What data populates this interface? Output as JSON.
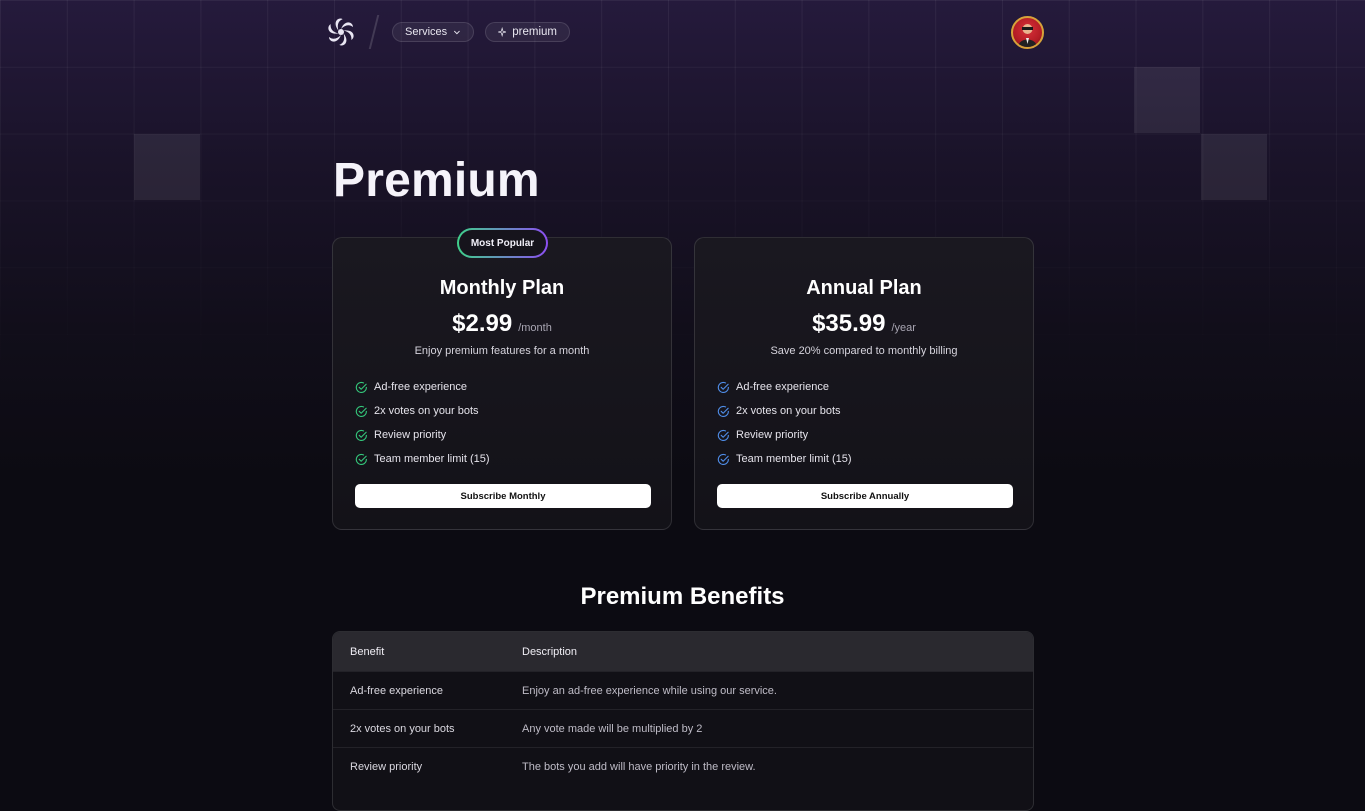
{
  "header": {
    "services_label": "Services",
    "premium_label": "premium",
    "logo_icon": "swirl-logo-icon",
    "avatar_icon": "user-avatar"
  },
  "page": {
    "title": "Premium"
  },
  "plans": [
    {
      "badge": "Most Popular",
      "name": "Monthly Plan",
      "price": "$2.99",
      "period": "/month",
      "description": "Enjoy premium features for a month",
      "features": [
        "Ad-free experience",
        "2x votes on your bots",
        "Review priority",
        "Team member limit (15)"
      ],
      "button": "Subscribe Monthly",
      "check_color": "#34c77b"
    },
    {
      "name": "Annual Plan",
      "price": "$35.99",
      "period": "/year",
      "description": "Save 20% compared to monthly billing",
      "features": [
        "Ad-free experience",
        "2x votes on your bots",
        "Review priority",
        "Team member limit (15)"
      ],
      "button": "Subscribe Annually",
      "check_color": "#4f8de8"
    }
  ],
  "benefits": {
    "title": "Premium Benefits",
    "columns": [
      "Benefit",
      "Description"
    ],
    "rows": [
      [
        "Ad-free experience",
        "Enjoy an ad-free experience while using our service."
      ],
      [
        "2x votes on your bots",
        "Any vote made will be multiplied by 2"
      ],
      [
        "Review priority",
        "The bots you add will have priority in the review."
      ]
    ]
  },
  "colors": {
    "badge_gradient_start": "#3fd08a",
    "badge_gradient_end": "#8c4ef2",
    "background": "#0c0b12"
  }
}
